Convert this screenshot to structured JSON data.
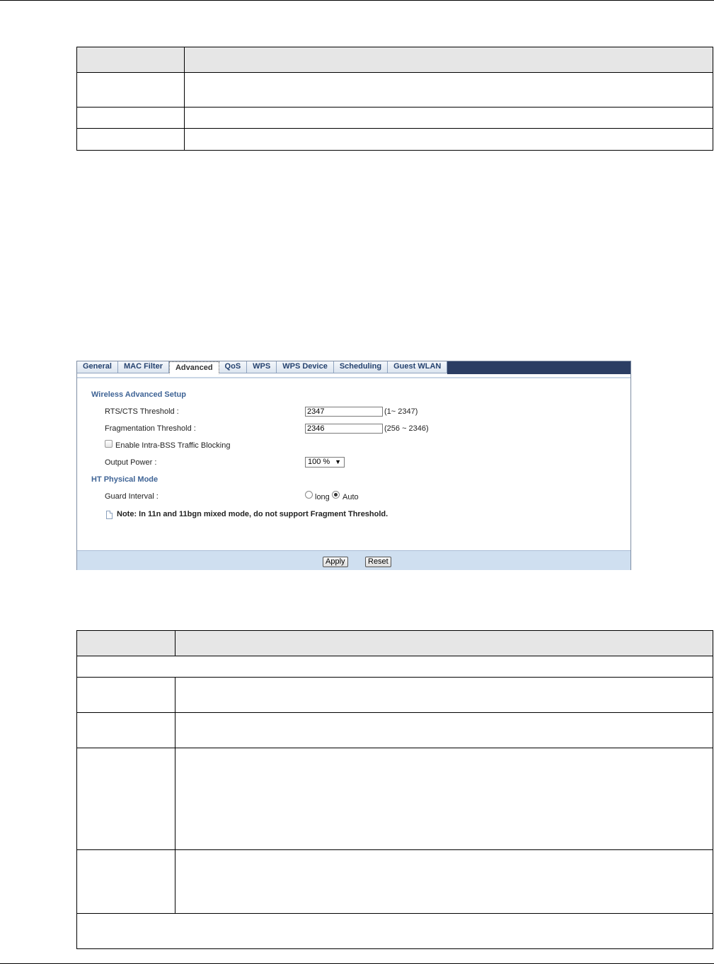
{
  "panel": {
    "tabs": [
      {
        "label": "General"
      },
      {
        "label": "MAC Filter"
      },
      {
        "label": "Advanced"
      },
      {
        "label": "QoS"
      },
      {
        "label": "WPS"
      },
      {
        "label": "WPS Device"
      },
      {
        "label": "Scheduling"
      },
      {
        "label": "Guest WLAN"
      }
    ],
    "active_tab": "Advanced",
    "wireless_advanced": {
      "title": "Wireless Advanced Setup",
      "rts_label": "RTS/CTS Threshold :",
      "rts_value": "2347",
      "rts_hint": "(1~ 2347)",
      "frag_label": "Fragmentation Threshold :",
      "frag_value": "2346",
      "frag_hint": "(256 ~ 2346)",
      "intra_bss_label": "Enable Intra-BSS Traffic Blocking",
      "output_power_label": "Output Power :",
      "output_power_value": "100 %"
    },
    "ht_mode": {
      "title": "HT Physical Mode",
      "guard_label": "Guard Interval :",
      "option_long": "long",
      "option_auto": "Auto",
      "selected": "Auto"
    },
    "note": "Note: In 11n and 11bgn mixed mode, do not support Fragment Threshold.",
    "buttons": {
      "apply": "Apply",
      "reset": "Reset"
    }
  }
}
